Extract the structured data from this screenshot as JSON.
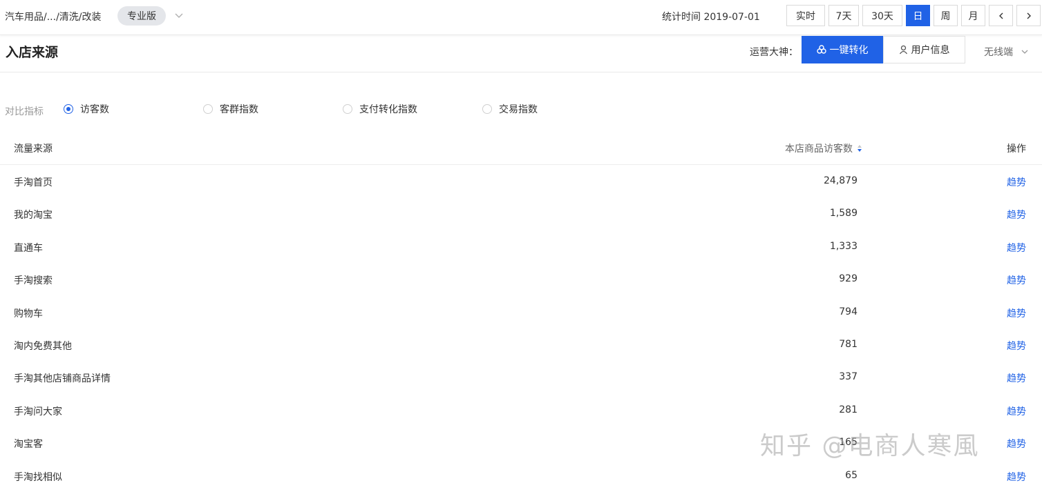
{
  "topbar": {
    "breadcrumb": "汽车用品/.../清洗/改装",
    "edition": "专业版",
    "stat_time": "统计时间 2019-07-01",
    "periods": [
      "实时",
      "7天",
      "30天",
      "日",
      "周",
      "月"
    ],
    "active_period": "日"
  },
  "section": {
    "title": "入店来源",
    "ops_label": "运营大神：",
    "convert_label": "一键转化",
    "userinfo_label": "用户信息",
    "device": "无线端"
  },
  "compare": {
    "label": "对比指标",
    "options": [
      "访客数",
      "客群指数",
      "支付转化指数",
      "交易指数"
    ],
    "selected": "访客数"
  },
  "table": {
    "headers": {
      "source": "流量来源",
      "visitors": "本店商品访客数",
      "action": "操作"
    },
    "rows": [
      {
        "source": "手淘首页",
        "visitors": "24,879",
        "action": "趋势"
      },
      {
        "source": "我的淘宝",
        "visitors": "1,589",
        "action": "趋势"
      },
      {
        "source": "直通车",
        "visitors": "1,333",
        "action": "趋势"
      },
      {
        "source": "手淘搜索",
        "visitors": "929",
        "action": "趋势"
      },
      {
        "source": "购物车",
        "visitors": "794",
        "action": "趋势"
      },
      {
        "source": "淘内免费其他",
        "visitors": "781",
        "action": "趋势"
      },
      {
        "source": "手淘其他店铺商品详情",
        "visitors": "337",
        "action": "趋势"
      },
      {
        "source": "手淘问大家",
        "visitors": "281",
        "action": "趋势"
      },
      {
        "source": "淘宝客",
        "visitors": "165",
        "action": "趋势"
      },
      {
        "source": "手淘找相似",
        "visitors": "65",
        "action": "趋势"
      }
    ]
  },
  "watermark": "知乎 @电商人寒風",
  "colors": {
    "accent": "#2062e6",
    "border": "#e8e8e8",
    "muted": "#999999"
  }
}
